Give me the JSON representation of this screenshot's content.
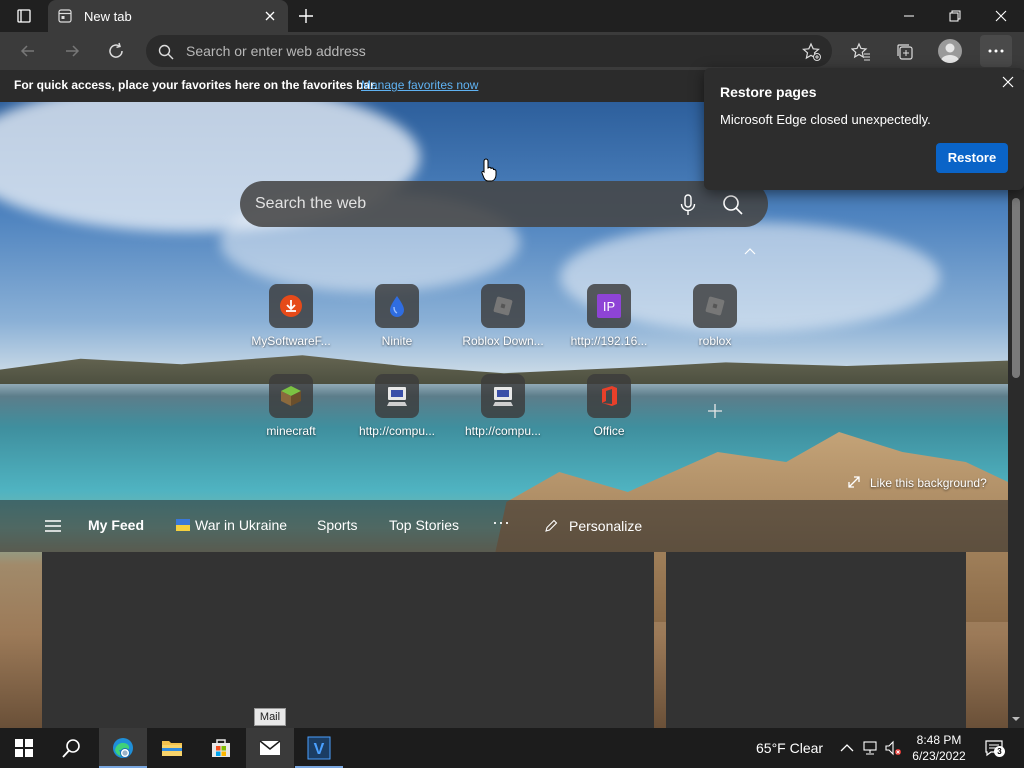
{
  "browser": {
    "tab_title": "New tab",
    "address_placeholder": "Search or enter web address"
  },
  "favorites_bar": {
    "message": "For quick access, place your favorites here on the favorites bar.",
    "link": "Manage favorites now"
  },
  "restore_popup": {
    "title": "Restore pages",
    "message": "Microsoft Edge closed unexpectedly.",
    "button": "Restore"
  },
  "newtab": {
    "search_placeholder": "Search the web",
    "quick_links": [
      {
        "label": "MySoftwareF...",
        "icon": "download-icon"
      },
      {
        "label": "Ninite",
        "icon": "ninite-icon"
      },
      {
        "label": "Roblox Down...",
        "icon": "roblox-icon"
      },
      {
        "label": "http://192.16...",
        "icon": "ip-icon"
      },
      {
        "label": "roblox",
        "icon": "roblox-icon"
      },
      {
        "label": "minecraft",
        "icon": "minecraft-icon"
      },
      {
        "label": "http://compu...",
        "icon": "computer-icon"
      },
      {
        "label": "http://compu...",
        "icon": "computer-icon"
      },
      {
        "label": "Office",
        "icon": "office-icon"
      }
    ],
    "like_background": "Like this background?",
    "feed_tabs": [
      "My Feed",
      "War in Ukraine",
      "Sports",
      "Top Stories"
    ],
    "more": "···",
    "personalize": "Personalize"
  },
  "taskbar": {
    "tooltip": "Mail",
    "weather": "65°F  Clear",
    "time": "8:48 PM",
    "date": "6/23/2022",
    "notification_count": "3"
  },
  "colors": {
    "accent": "#0a64c8",
    "link": "#5fb2f2",
    "chrome_dark": "#202020",
    "toolbar": "#3b3b3b"
  }
}
